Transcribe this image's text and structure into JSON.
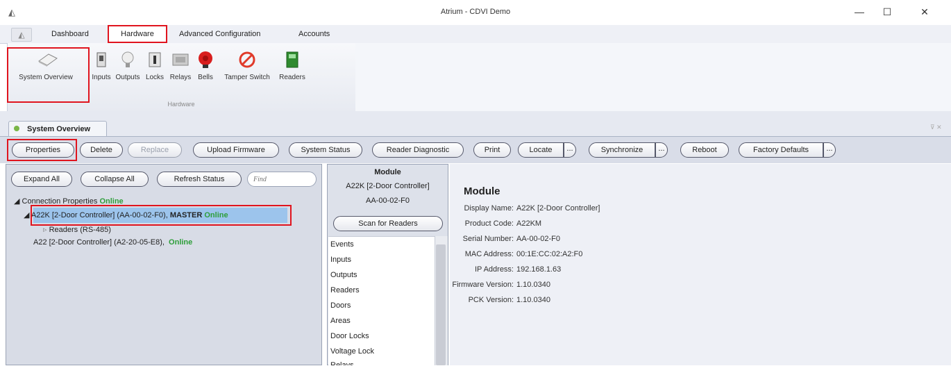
{
  "window": {
    "title": "Atrium - CDVI Demo",
    "logo_glyph": "◭"
  },
  "ribbon": {
    "tabs": [
      "Dashboard",
      "Hardware",
      "Advanced Configuration",
      "Accounts"
    ],
    "buttons": [
      "System Overview",
      "Inputs",
      "Outputs",
      "Locks",
      "Relays",
      "Bells",
      "Tamper Switch",
      "Readers"
    ],
    "group_label": "Hardware"
  },
  "doc_tab": {
    "title": "System Overview"
  },
  "toolbar": {
    "properties": "Properties",
    "delete": "Delete",
    "replace": "Replace",
    "upload_firmware": "Upload Firmware",
    "system_status": "System Status",
    "reader_diagnostic": "Reader Diagnostic",
    "print": "Print",
    "locate": "Locate",
    "synchronize": "Synchronize",
    "reboot": "Reboot",
    "factory_defaults": "Factory Defaults",
    "more": "..."
  },
  "left": {
    "expand_all": "Expand All",
    "collapse_all": "Collapse All",
    "refresh_status": "Refresh Status",
    "find_placeholder": "Find",
    "conn_label": "Connection Properties",
    "conn_status": "Online",
    "node1": "A22K [2-Door Controller] (AA-00-02-F0),",
    "node1_master": "MASTER",
    "node1_status": "Online",
    "node1_child": "Readers   (RS-485)",
    "node2": "A22 [2-Door Controller] (A2-20-05-E8),",
    "node2_status": "Online"
  },
  "middle": {
    "title": "Module",
    "device": "A22K [2-Door Controller]",
    "serial": "AA-00-02-F0",
    "scan": "Scan for Readers",
    "list": [
      "Events",
      "Inputs",
      "Outputs",
      "Readers",
      "Doors",
      "Areas",
      "Door Locks",
      "Voltage Lock",
      "Relays"
    ]
  },
  "detail": {
    "heading": "Module",
    "fields": [
      {
        "label": "Display Name:",
        "value": "A22K [2-Door Controller]"
      },
      {
        "label": "Product Code:",
        "value": "A22KM"
      },
      {
        "label": "Serial Number:",
        "value": "AA-00-02-F0"
      },
      {
        "label": "MAC Address:",
        "value": "00:1E:CC:02:A2:F0"
      },
      {
        "label": "IP Address:",
        "value": "192.168.1.63"
      },
      {
        "label": "Firmware Version:",
        "value": "1.10.0340"
      },
      {
        "label": "PCK Version:",
        "value": "1.10.0340"
      }
    ]
  },
  "colors": {
    "highlight": "#e0141e",
    "online": "#2e9e3a",
    "selection": "#9cc4ec"
  }
}
